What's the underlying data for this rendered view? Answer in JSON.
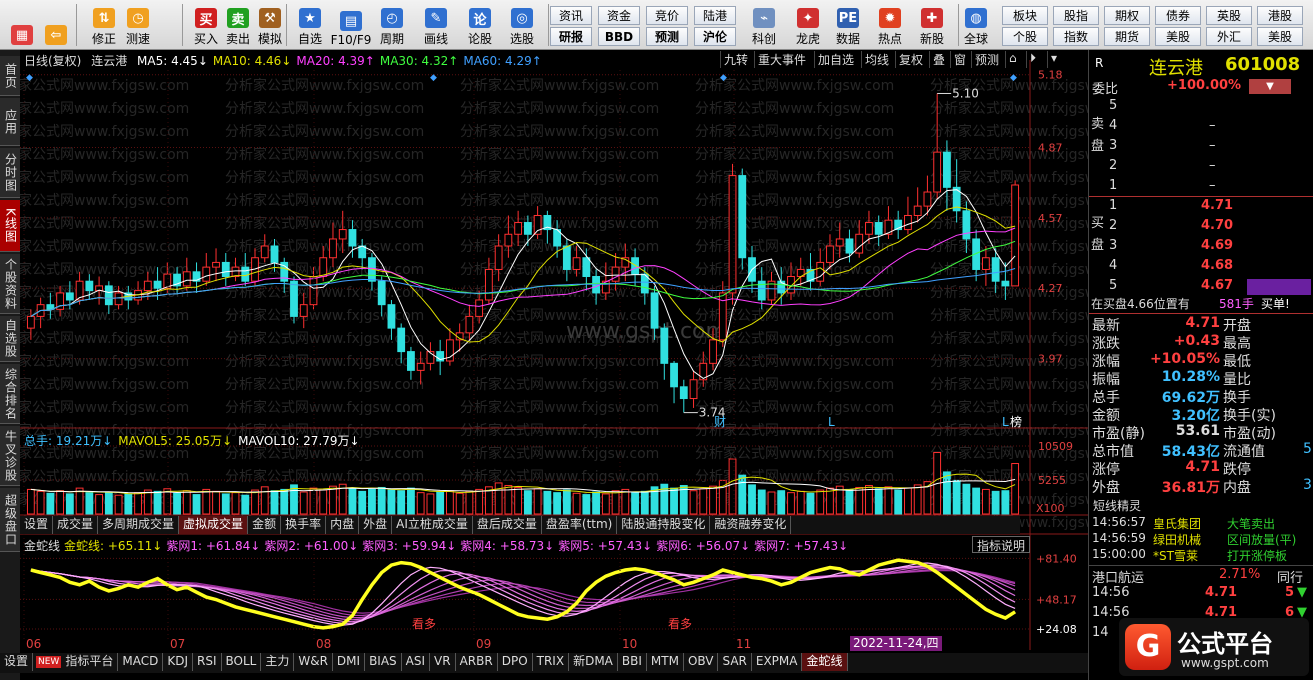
{
  "toolbar": {
    "big_buttons": [
      {
        "label": "",
        "icon": "grid-app-icon",
        "color": "#e04040"
      },
      {
        "label": "",
        "icon": "back-arrow-icon",
        "color": "#f0a020"
      },
      {
        "label": "修正",
        "icon": "up-down-arrow-icon",
        "color": "#f0a020"
      },
      {
        "label": "测速",
        "icon": "speed-test-icon",
        "color": "#f0a020"
      },
      {
        "label": "买入",
        "icon": "buy-icon",
        "color": "#d02020"
      },
      {
        "label": "卖出",
        "icon": "sell-icon",
        "color": "#20a020"
      },
      {
        "label": "模拟",
        "icon": "hammer-icon",
        "color": "#a06020"
      },
      {
        "label": "自选",
        "icon": "favorite-star-icon",
        "color": "#3070d0"
      },
      {
        "label": "F10/F9",
        "icon": "f10-info-icon",
        "color": "#3070d0"
      },
      {
        "label": "周期",
        "icon": "cycle-icon",
        "color": "#3070d0"
      },
      {
        "label": "画线",
        "icon": "draw-line-icon",
        "color": "#3070d0"
      },
      {
        "label": "论股",
        "icon": "discussion-icon",
        "color": "#3070d0"
      },
      {
        "label": "选股",
        "icon": "stock-picker-icon",
        "color": "#3070d0"
      }
    ],
    "small_row1": [
      "资讯",
      "资金",
      "竞价",
      "陆港",
      "",
      "",
      "",
      "",
      ""
    ],
    "small_row2": [
      "研报",
      "BBD",
      "预测",
      "沪伦",
      "",
      "",
      "",
      "",
      ""
    ],
    "icon_buttons": [
      {
        "label": "科创",
        "icon": "kechuang-icon"
      },
      {
        "label": "龙虎",
        "icon": "dragon-tiger-icon"
      },
      {
        "label": "数据",
        "icon": "pe-data-icon"
      },
      {
        "label": "热点",
        "icon": "hot-spot-icon"
      },
      {
        "label": "新股",
        "icon": "new-stock-icon"
      },
      {
        "label": "全球",
        "icon": "globe-icon"
      }
    ],
    "right_row1": [
      "板块",
      "股指",
      "期权",
      "债券",
      "英股",
      "港股"
    ],
    "right_row2": [
      "个股",
      "指数",
      "期货",
      "美股",
      "外汇",
      "美股"
    ]
  },
  "left_tabs": [
    "首页",
    "应用",
    "分时图",
    "K线图",
    "个股资料",
    "自选股",
    "综合排名",
    "牛叉诊股",
    "超级盘口"
  ],
  "kline": {
    "header": "日线(复权)",
    "stock_name": "连云港",
    "ma": [
      {
        "label": "MA5: 4.45",
        "arrow": "↓",
        "color": "#ffffff"
      },
      {
        "label": "MA10: 4.46",
        "arrow": "↓",
        "color": "#e0e000"
      },
      {
        "label": "MA20: 4.39",
        "arrow": "↑",
        "color": "#ff40ff"
      },
      {
        "label": "MA30: 4.32",
        "arrow": "↑",
        "color": "#40ff40"
      },
      {
        "label": "MA60: 4.29",
        "arrow": "↑",
        "color": "#40a0ff"
      }
    ],
    "right_buttons": [
      "九转",
      "重大事件",
      "加自选",
      "均线",
      "复权",
      "叠",
      "窗",
      "预测",
      "⌂",
      "⏵",
      "▾"
    ],
    "y_axis": [
      "5.18",
      "4.87",
      "4.57",
      "4.27",
      "3.97"
    ],
    "high_label": "5.10",
    "low_label": "3.74",
    "markers": [
      "财",
      "L",
      "L",
      "榜"
    ],
    "watermark": "分析家公式网www.fxjgsw.com",
    "site_watermark": "www.gspt.com"
  },
  "volume": {
    "header": [
      {
        "label": "总手: 19.21万",
        "arrow": "↓",
        "color": "#40c0ff"
      },
      {
        "label": "MAVOL5: 25.05万",
        "arrow": "↓",
        "color": "#e0e000"
      },
      {
        "label": "MAVOL10: 27.79万",
        "arrow": "↓",
        "color": "#ffffff"
      }
    ],
    "y_axis": [
      "10509",
      "5255",
      "X100"
    ]
  },
  "indicator_tabs": [
    "设置",
    "成交量",
    "多周期成交量",
    "虚拟成交量",
    "金额",
    "换手率",
    "内盘",
    "外盘",
    "AI立桩成交量",
    "盘后成交量",
    "盘盈率(ttm)",
    "陆股通持股变化",
    "融资融券变化"
  ],
  "indicator": {
    "name": "金蛇线",
    "values": [
      {
        "label": "金蛇线: +65.11",
        "arrow": "↓",
        "color": "#e0e000"
      },
      {
        "label": "紫网1: +61.84",
        "arrow": "↓",
        "color": "#ff60ff"
      },
      {
        "label": "紫网2: +61.00",
        "arrow": "↓",
        "color": "#ff60ff"
      },
      {
        "label": "紫网3: +59.94",
        "arrow": "↓",
        "color": "#ff60ff"
      },
      {
        "label": "紫网4: +58.73",
        "arrow": "↓",
        "color": "#ff60ff"
      },
      {
        "label": "紫网5: +57.43",
        "arrow": "↓",
        "color": "#ff60ff"
      },
      {
        "label": "紫网6: +56.07",
        "arrow": "↓",
        "color": "#ff60ff"
      },
      {
        "label": "紫网7: +57.43",
        "arrow": "↓",
        "color": "#ff60ff"
      }
    ],
    "explain_button": "指标说明",
    "y_axis": [
      "+81.40",
      "+48.17",
      "+24.08"
    ],
    "labels": [
      "看多",
      "看多"
    ]
  },
  "x_axis": [
    "06",
    "07",
    "08",
    "09",
    "10",
    "11"
  ],
  "date_badge": "2022-11-24,四",
  "bottom_tabs": [
    "设置",
    "NEW",
    "指标平台",
    "MACD",
    "KDJ",
    "RSI",
    "BOLL",
    "主力",
    "W&R",
    "DMI",
    "BIAS",
    "ASI",
    "VR",
    "ARBR",
    "DPO",
    "TRIX",
    "新DMA",
    "BBI",
    "MTM",
    "OBV",
    "SAR",
    "EXPMA",
    "金蛇线"
  ],
  "quote": {
    "badge": "R",
    "name": "连云港",
    "code": "601008",
    "weibi_label": "委比",
    "weibi_value": "+100.00%",
    "sell_label": "卖盘",
    "buy_label": "买盘",
    "sell": [
      {
        "n": "5",
        "price": "",
        "vol": ""
      },
      {
        "n": "4",
        "price": "–",
        "vol": ""
      },
      {
        "n": "3",
        "price": "–",
        "vol": ""
      },
      {
        "n": "2",
        "price": "–",
        "vol": ""
      },
      {
        "n": "1",
        "price": "–",
        "vol": ""
      }
    ],
    "buy": [
      {
        "n": "1",
        "price": "4.71",
        "vol": ""
      },
      {
        "n": "2",
        "price": "4.70",
        "vol": ""
      },
      {
        "n": "3",
        "price": "4.69",
        "vol": ""
      },
      {
        "n": "4",
        "price": "4.68",
        "vol": ""
      },
      {
        "n": "5",
        "price": "4.67",
        "vol": ""
      }
    ],
    "position_line": {
      "text": "在买盘4.66位置有",
      "vol": "581手",
      "action": "买单!"
    },
    "stats": [
      {
        "k1": "最新",
        "v1": "4.71",
        "c1": "red",
        "k2": "开盘",
        "v2": ""
      },
      {
        "k1": "涨跌",
        "v1": "+0.43",
        "c1": "red",
        "k2": "最高",
        "v2": ""
      },
      {
        "k1": "涨幅",
        "v1": "+10.05%",
        "c1": "red",
        "k2": "最低",
        "v2": ""
      },
      {
        "k1": "振幅",
        "v1": "10.28%",
        "c1": "cyan",
        "k2": "量比",
        "v2": ""
      },
      {
        "k1": "总手",
        "v1": "69.62万",
        "c1": "cyan",
        "k2": "换手",
        "v2": ""
      },
      {
        "k1": "金额",
        "v1": "3.20亿",
        "c1": "cyan",
        "k2": "换手(实)",
        "v2": ""
      },
      {
        "k1": "市盈(静)",
        "v1": "53.61",
        "c1": "white",
        "k2": "市盈(动)",
        "v2": ""
      },
      {
        "k1": "总市值",
        "v1": "58.43亿",
        "c1": "cyan",
        "k2": "流通值",
        "v2": "5"
      },
      {
        "k1": "涨停",
        "v1": "4.71",
        "c1": "red",
        "k2": "跌停",
        "v2": ""
      },
      {
        "k1": "外盘",
        "v1": "36.81万",
        "c1": "red",
        "k2": "内盘",
        "v2": "3"
      }
    ],
    "elves_title": "短线精灵",
    "elves": [
      {
        "time": "14:56:57",
        "name": "皇氏集团",
        "event": "大笔卖出"
      },
      {
        "time": "14:56:59",
        "name": "绿田机械",
        "event": "区间放量(平)"
      },
      {
        "time": "15:00:00",
        "name": "*ST雪莱",
        "event": "打开涨停板"
      }
    ],
    "sector_name": "港口航运",
    "sector_pct": "2.71%",
    "sector_tab": "同行",
    "ticks": [
      {
        "time": "14:56",
        "price": "4.71",
        "vol": "5"
      },
      {
        "time": "14:56",
        "price": "4.71",
        "vol": "6"
      },
      {
        "time": "14",
        "price": "",
        "vol": ""
      }
    ],
    "logo_text": "公式平台",
    "logo_url": "www.gspt.com"
  },
  "chart_data": {
    "type": "candlestick",
    "price_range": [
      3.7,
      5.2
    ],
    "candles": [
      [
        4.1,
        4.15,
        4.05,
        4.18
      ],
      [
        4.15,
        4.2,
        4.1,
        4.23
      ],
      [
        4.2,
        4.18,
        4.14,
        4.25
      ],
      [
        4.18,
        4.25,
        4.15,
        4.28
      ],
      [
        4.25,
        4.22,
        4.18,
        4.3
      ],
      [
        4.22,
        4.3,
        4.2,
        4.34
      ],
      [
        4.3,
        4.26,
        4.22,
        4.33
      ],
      [
        4.26,
        4.28,
        4.2,
        4.32
      ],
      [
        4.28,
        4.2,
        4.16,
        4.3
      ],
      [
        4.2,
        4.25,
        4.18,
        4.28
      ],
      [
        4.25,
        4.22,
        4.18,
        4.28
      ],
      [
        4.22,
        4.26,
        4.2,
        4.3
      ],
      [
        4.26,
        4.3,
        4.22,
        4.34
      ],
      [
        4.3,
        4.27,
        4.22,
        4.36
      ],
      [
        4.27,
        4.33,
        4.25,
        4.38
      ],
      [
        4.33,
        4.28,
        4.25,
        4.36
      ],
      [
        4.28,
        4.34,
        4.26,
        4.4
      ],
      [
        4.34,
        4.3,
        4.25,
        4.38
      ],
      [
        4.3,
        4.36,
        4.28,
        4.42
      ],
      [
        4.36,
        4.38,
        4.3,
        4.44
      ],
      [
        4.38,
        4.32,
        4.28,
        4.42
      ],
      [
        4.32,
        4.36,
        4.3,
        4.4
      ],
      [
        4.36,
        4.3,
        4.28,
        4.42
      ],
      [
        4.3,
        4.4,
        4.28,
        4.44
      ],
      [
        4.4,
        4.45,
        4.38,
        4.5
      ],
      [
        4.45,
        4.38,
        4.34,
        4.48
      ],
      [
        4.38,
        4.3,
        4.25,
        4.4
      ],
      [
        4.3,
        4.15,
        4.12,
        4.32
      ],
      [
        4.15,
        4.2,
        4.1,
        4.25
      ],
      [
        4.2,
        4.32,
        4.18,
        4.36
      ],
      [
        4.32,
        4.4,
        4.3,
        4.45
      ],
      [
        4.4,
        4.48,
        4.36,
        4.55
      ],
      [
        4.48,
        4.52,
        4.42,
        4.6
      ],
      [
        4.52,
        4.45,
        4.4,
        4.56
      ],
      [
        4.45,
        4.4,
        4.35,
        4.48
      ],
      [
        4.4,
        4.3,
        4.26,
        4.42
      ],
      [
        4.3,
        4.2,
        4.15,
        4.32
      ],
      [
        4.2,
        4.1,
        4.05,
        4.22
      ],
      [
        4.1,
        4.0,
        3.95,
        4.12
      ],
      [
        4.0,
        3.92,
        3.88,
        4.02
      ],
      [
        3.92,
        3.95,
        3.86,
        4.0
      ],
      [
        3.95,
        4.0,
        3.92,
        4.04
      ],
      [
        4.0,
        3.96,
        3.9,
        4.05
      ],
      [
        3.96,
        4.05,
        3.94,
        4.1
      ],
      [
        4.05,
        4.08,
        4.0,
        4.12
      ],
      [
        4.08,
        4.15,
        4.05,
        4.2
      ],
      [
        4.15,
        4.22,
        4.12,
        4.26
      ],
      [
        4.22,
        4.35,
        4.2,
        4.4
      ],
      [
        4.35,
        4.45,
        4.3,
        4.5
      ],
      [
        4.45,
        4.5,
        4.4,
        4.58
      ],
      [
        4.5,
        4.55,
        4.45,
        4.6
      ],
      [
        4.55,
        4.5,
        4.45,
        4.58
      ],
      [
        4.5,
        4.58,
        4.48,
        4.62
      ],
      [
        4.58,
        4.52,
        4.46,
        4.6
      ],
      [
        4.52,
        4.45,
        4.4,
        4.56
      ],
      [
        4.45,
        4.35,
        4.3,
        4.48
      ],
      [
        4.35,
        4.4,
        4.32,
        4.45
      ],
      [
        4.4,
        4.32,
        4.26,
        4.44
      ],
      [
        4.32,
        4.25,
        4.2,
        4.35
      ],
      [
        4.25,
        4.3,
        4.22,
        4.38
      ],
      [
        4.3,
        4.36,
        4.26,
        4.42
      ],
      [
        4.36,
        4.4,
        4.3,
        4.46
      ],
      [
        4.4,
        4.33,
        4.28,
        4.44
      ],
      [
        4.33,
        4.25,
        4.2,
        4.36
      ],
      [
        4.25,
        4.1,
        4.05,
        4.28
      ],
      [
        4.1,
        3.95,
        3.88,
        4.12
      ],
      [
        3.95,
        3.85,
        3.78,
        3.96
      ],
      [
        3.85,
        3.8,
        3.74,
        3.88
      ],
      [
        3.8,
        3.88,
        3.76,
        3.92
      ],
      [
        3.88,
        3.95,
        3.85,
        4.0
      ],
      [
        3.95,
        4.05,
        3.92,
        4.1
      ],
      [
        4.05,
        4.25,
        4.02,
        4.3
      ],
      [
        4.25,
        4.75,
        4.2,
        4.8
      ],
      [
        4.75,
        4.4,
        4.35,
        4.78
      ],
      [
        4.4,
        4.3,
        4.25,
        4.45
      ],
      [
        4.3,
        4.22,
        4.18,
        4.36
      ],
      [
        4.22,
        4.3,
        4.2,
        4.34
      ],
      [
        4.3,
        4.25,
        4.2,
        4.36
      ],
      [
        4.25,
        4.32,
        4.22,
        4.38
      ],
      [
        4.32,
        4.35,
        4.28,
        4.4
      ],
      [
        4.35,
        4.3,
        4.26,
        4.42
      ],
      [
        4.3,
        4.38,
        4.28,
        4.44
      ],
      [
        4.38,
        4.45,
        4.35,
        4.5
      ],
      [
        4.45,
        4.48,
        4.4,
        4.55
      ],
      [
        4.48,
        4.42,
        4.38,
        4.52
      ],
      [
        4.42,
        4.5,
        4.4,
        4.56
      ],
      [
        4.5,
        4.55,
        4.46,
        4.6
      ],
      [
        4.55,
        4.5,
        4.45,
        4.58
      ],
      [
        4.5,
        4.56,
        4.48,
        4.62
      ],
      [
        4.56,
        4.52,
        4.48,
        4.6
      ],
      [
        4.52,
        4.58,
        4.5,
        4.66
      ],
      [
        4.58,
        4.62,
        4.55,
        4.7
      ],
      [
        4.62,
        4.68,
        4.58,
        4.75
      ],
      [
        4.68,
        4.85,
        4.65,
        5.1
      ],
      [
        4.85,
        4.7,
        4.6,
        4.9
      ],
      [
        4.7,
        4.6,
        4.55,
        4.82
      ],
      [
        4.6,
        4.48,
        4.42,
        4.64
      ],
      [
        4.48,
        4.35,
        4.3,
        4.52
      ],
      [
        4.35,
        4.4,
        4.28,
        4.45
      ],
      [
        4.4,
        4.3,
        4.25,
        4.44
      ],
      [
        4.3,
        4.28,
        4.22,
        4.38
      ],
      [
        4.28,
        4.71,
        4.28,
        4.73
      ]
    ],
    "volume_range": [
      0,
      10509
    ],
    "volume": [
      3800,
      3500,
      3200,
      3600,
      3100,
      4000,
      3300,
      3000,
      3400,
      2900,
      3100,
      3300,
      3700,
      3500,
      3900,
      3200,
      3600,
      3000,
      3800,
      3500,
      3100,
      3300,
      2900,
      3700,
      4200,
      3600,
      3800,
      4500,
      3400,
      4000,
      3700,
      4300,
      4600,
      3900,
      3500,
      3800,
      4100,
      3700,
      3600,
      4000,
      3300,
      3100,
      3400,
      3600,
      3200,
      3500,
      3800,
      4200,
      4800,
      4400,
      4100,
      3600,
      3900,
      3500,
      3300,
      3700,
      3200,
      3000,
      3400,
      3100,
      3600,
      3800,
      3300,
      3500,
      4200,
      4600,
      4000,
      4400,
      3600,
      3900,
      4300,
      5200,
      8500,
      6000,
      4500,
      3700,
      3400,
      3600,
      3300,
      3500,
      3200,
      3700,
      4000,
      4300,
      3800,
      4100,
      4400,
      3900,
      4200,
      3700,
      4000,
      4500,
      5000,
      9500,
      6500,
      5200,
      4600,
      4000,
      3800,
      3500,
      3600,
      7800
    ],
    "indicator_range": [
      20,
      85
    ],
    "jinshe": [
      72,
      70,
      68,
      66,
      62,
      60,
      63,
      58,
      55,
      57,
      60,
      58,
      62,
      65,
      60,
      56,
      58,
      54,
      50,
      48,
      45,
      42,
      40,
      38,
      36,
      34,
      32,
      30,
      28,
      26,
      25,
      26,
      28,
      35,
      48,
      60,
      70,
      76,
      78,
      77,
      74,
      70,
      66,
      62,
      58,
      55,
      52,
      48,
      44,
      40,
      36,
      34,
      33,
      32,
      34,
      38,
      45,
      55,
      62,
      67,
      70,
      72,
      73,
      72,
      70,
      67,
      64,
      60,
      62,
      65,
      68,
      72,
      70,
      68,
      66,
      65,
      63,
      60,
      62,
      66,
      70,
      72,
      74,
      73,
      70,
      68,
      72,
      76,
      78,
      80,
      79,
      78,
      75,
      70,
      64,
      58,
      52,
      46,
      40,
      36,
      33,
      38
    ]
  }
}
